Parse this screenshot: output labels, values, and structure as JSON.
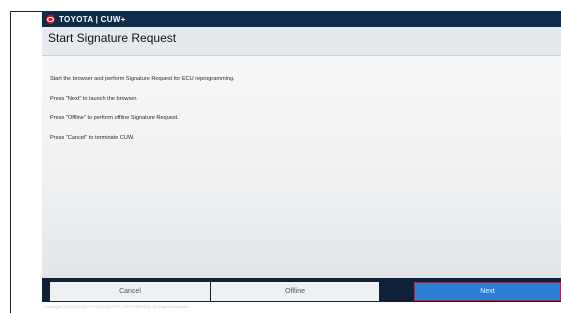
{
  "app": {
    "title": "TOYOTA | CUW+",
    "logo_icon": "toyota-logo-icon",
    "brand_color": "#d71920"
  },
  "page": {
    "title": "Start Signature Request"
  },
  "instructions": [
    "Start the browser and perform Signature Request for ECU reprogramming.",
    "Press \"Next\" to launch the browser.",
    "Press \"Offline\" to perform offline Signature Request.",
    "Press \"Cancel\" to terminate CUW."
  ],
  "buttons": {
    "cancel": "Cancel",
    "offline": "Offline",
    "next": "Next"
  },
  "footer": {
    "copyright": "Copyright (c) 2019-2024 TOYOTA MOTOR CORPORATION. All Rights Reserved."
  }
}
